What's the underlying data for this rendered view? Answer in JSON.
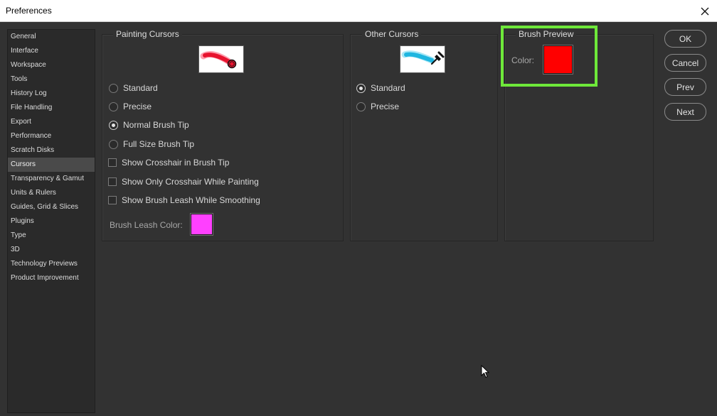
{
  "window": {
    "title": "Preferences"
  },
  "sidebar": {
    "items": [
      {
        "label": "General"
      },
      {
        "label": "Interface"
      },
      {
        "label": "Workspace"
      },
      {
        "label": "Tools"
      },
      {
        "label": "History Log"
      },
      {
        "label": "File Handling"
      },
      {
        "label": "Export"
      },
      {
        "label": "Performance"
      },
      {
        "label": "Scratch Disks"
      },
      {
        "label": "Cursors",
        "selected": true
      },
      {
        "label": "Transparency & Gamut"
      },
      {
        "label": "Units & Rulers"
      },
      {
        "label": "Guides, Grid & Slices"
      },
      {
        "label": "Plugins"
      },
      {
        "label": "Type"
      },
      {
        "label": "3D"
      },
      {
        "label": "Technology Previews"
      },
      {
        "label": "Product Improvement"
      }
    ]
  },
  "painting_cursors": {
    "title": "Painting Cursors",
    "options": [
      {
        "label": "Standard",
        "checked": false
      },
      {
        "label": "Precise",
        "checked": false
      },
      {
        "label": "Normal Brush Tip",
        "checked": true
      },
      {
        "label": "Full Size Brush Tip",
        "checked": false
      }
    ],
    "checkboxes": [
      {
        "label": "Show Crosshair in Brush Tip",
        "checked": false
      },
      {
        "label": "Show Only Crosshair While Painting",
        "checked": false
      },
      {
        "label": "Show Brush Leash While Smoothing",
        "checked": false
      }
    ],
    "leash_color_label": "Brush Leash Color:",
    "leash_color": "#ff40ff"
  },
  "other_cursors": {
    "title": "Other Cursors",
    "options": [
      {
        "label": "Standard",
        "checked": true
      },
      {
        "label": "Precise",
        "checked": false
      }
    ]
  },
  "brush_preview": {
    "title": "Brush Preview",
    "color_label": "Color:",
    "color": "#ff0000"
  },
  "buttons": {
    "ok": "OK",
    "cancel": "Cancel",
    "prev": "Prev",
    "next": "Next"
  },
  "colors": {
    "highlight": "#6ee83a",
    "panel_bg": "#323232"
  }
}
